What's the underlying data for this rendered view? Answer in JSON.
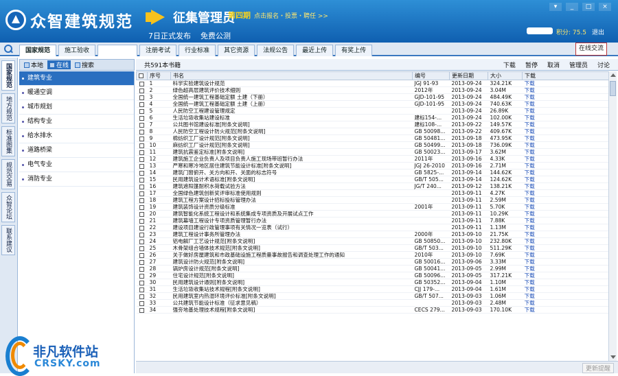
{
  "header": {
    "app_title": "众智建筑规范",
    "promo_title": "征集管理员",
    "promo_phase": "第四期",
    "promo_slogan": "点击报名・投票・聘任 >>",
    "promo_line_a": "7日正式发布",
    "promo_line_b": "免费公测",
    "score_label": "积分: 75.5",
    "logout": "退出",
    "window_buttons": [
      "▾",
      "_",
      "□",
      "×"
    ]
  },
  "tabs": [
    "国家规范",
    "施工验收",
    "",
    "注册考试",
    "行业标准",
    "其它资源",
    "法规公告",
    "最近上传",
    "有奖上传"
  ],
  "online_chat": "在线交流",
  "vertical_tabs": [
    "国家规范",
    "地方规范",
    "标准图集",
    "规范交易",
    "众智论坛",
    "联系建议"
  ],
  "left_toolbar": {
    "local": "本地",
    "online": "在线",
    "search": "搜索"
  },
  "categories": [
    "建筑专业",
    "暖通空调",
    "城市规划",
    "结构专业",
    "给水排水",
    "道路桥梁",
    "电气专业",
    "消防专业"
  ],
  "toolbar": {
    "count": "共591本书籍",
    "actions": [
      "下载",
      "暂停",
      "取消",
      "管理员",
      "讨论"
    ]
  },
  "table": {
    "headers": [
      "序号",
      "书名",
      "编号",
      "更新日期",
      "大小",
      "下载"
    ],
    "rows": [
      [
        "1",
        "科学实验建筑设计规范",
        "JGJ 91-93",
        "2013-09-24",
        "324.21K",
        "下载"
      ],
      [
        "2",
        "绿色超高层建筑评价技术细则",
        "2012年",
        "2013-09-24",
        "3.04M",
        "下载"
      ],
      [
        "3",
        "全国统一建筑工程基础定额 土建（下册）",
        "GJD-101-95",
        "2013-09-24",
        "484.49K",
        "下载"
      ],
      [
        "4",
        "全国统一建筑工程基础定额 土建（上册）",
        "GJD-101-95",
        "2013-09-24",
        "740.63K",
        "下载"
      ],
      [
        "5",
        "人民防空工程建设管理规定",
        "",
        "2013-09-24",
        "26.89K",
        "下载"
      ],
      [
        "6",
        "生活垃圾收集站建设标准",
        "建标154-...",
        "2013-09-24",
        "102.00K",
        "下载"
      ],
      [
        "7",
        "公共图书馆建设标准[附条文说明]",
        "建标108-...",
        "2013-09-22",
        "149.57K",
        "下载"
      ],
      [
        "8",
        "人民防空工程设计防火规范[附条文说明]",
        "GB 50098...",
        "2013-09-22",
        "409.67K",
        "下载"
      ],
      [
        "9",
        "棉纺织工厂设计规范[附条文说明]",
        "GB 50481...",
        "2013-09-18",
        "473.95K",
        "下载"
      ],
      [
        "10",
        "麻纺织工厂设计规范[附条文说明]",
        "GB 50499...",
        "2013-09-18",
        "736.09K",
        "下载"
      ],
      [
        "11",
        "建筑抗震鉴定标准[附条文说明]",
        "GB 50023...",
        "2013-09-17",
        "3.62M",
        "下载"
      ],
      [
        "12",
        "建筑施工企业负责人及项目负责人施工现场带班暂行办法",
        "2011年",
        "2013-09-16",
        "4.33K",
        "下载"
      ],
      [
        "13",
        "严寒和寒冷地区居住建筑节能设计标准[附条文说明]",
        "JGJ 26-2010",
        "2013-09-16",
        "2.71M",
        "下载"
      ],
      [
        "14",
        "建筑门窗俯开、关方向和开、关面的标志符号",
        "GB 5825-...",
        "2013-09-14",
        "144.62K",
        "下载"
      ],
      [
        "15",
        "民用建筑设计术语标准[附条文说明]",
        "GB/T 505...",
        "2013-09-14",
        "124.62K",
        "下载"
      ],
      [
        "16",
        "建筑遮阳篷耐积水荷载试验方法",
        "JG/T 240...",
        "2013-09-12",
        "138.21K",
        "下载"
      ],
      [
        "17",
        "全国绿色建筑创新奖评审标准使用规则",
        "",
        "2013-09-11",
        "4.27K",
        "下载"
      ],
      [
        "18",
        "建筑工程方案设计招标投标管理办法",
        "",
        "2013-09-11",
        "2.59M",
        "下载"
      ],
      [
        "19",
        "建筑装饰设计资质分级标准",
        "2001年",
        "2013-09-11",
        "5.70K",
        "下载"
      ],
      [
        "20",
        "建筑智能化系统工程设计和系统集成专项资质及开展试点工作",
        "",
        "2013-09-11",
        "10.29K",
        "下载"
      ],
      [
        "21",
        "建筑幕墙工程设计专项资质管理暂行办法",
        "",
        "2013-09-11",
        "7.88K",
        "下载"
      ],
      [
        "22",
        "建设项目建设行政管理事项有关情况一览表（试行）",
        "",
        "2013-09-11",
        "1.13M",
        "下载"
      ],
      [
        "23",
        "建筑工程设计事务所管理办法",
        "2000年",
        "2013-09-10",
        "21.75K",
        "下载"
      ],
      [
        "24",
        "铝电解厂工艺设计规范[附条文说明]",
        "GB 50850...",
        "2013-09-10",
        "232.80K",
        "下载"
      ],
      [
        "25",
        "木骨架组合墙体技术规范[附条文说明]",
        "GB/T 503...",
        "2013-09-10",
        "511.29K",
        "下载"
      ],
      [
        "26",
        "关于做好房屋建筑和市政基础设施工程质量事故报告和调查处理工作的通知",
        "2010年",
        "2013-09-10",
        "7.69K",
        "下载"
      ],
      [
        "27",
        "建筑设计防火规范[附条文说明]",
        "GB 50016...",
        "2013-09-06",
        "3.33M",
        "下载"
      ],
      [
        "28",
        "锅炉房设计规范[附条文说明]",
        "GB 50041...",
        "2013-09-05",
        "2.99M",
        "下载"
      ],
      [
        "29",
        "住宅设计规范[附条文说明]",
        "GB 50096...",
        "2013-09-05",
        "317.21K",
        "下载"
      ],
      [
        "30",
        "民用建筑设计通则[附条文说明]",
        "GB 50352...",
        "2013-09-04",
        "1.10M",
        "下载"
      ],
      [
        "31",
        "生活垃圾收集站技术规程[附条文说明]",
        "CJJ 179-...",
        "2013-09-04",
        "1.61M",
        "下载"
      ],
      [
        "32",
        "民用建筑室内热湿环境评价标准[附条文说明]",
        "GB/T 507...",
        "2013-09-03",
        "1.06M",
        "下载"
      ],
      [
        "33",
        "公共建筑节能设计标准（征求意见稿）",
        "",
        "2013-09-03",
        "2.48M",
        "下载"
      ],
      [
        "34",
        "强夯地基处理技术规程[附条文说明]",
        "CECS 279...",
        "2013-09-03",
        "170.10K",
        "下载"
      ]
    ]
  },
  "status_button": "更新提醒",
  "watermark": {
    "text": "非凡软件站",
    "url": "CRSKY.com"
  },
  "colors": {
    "banner": "#1a6fc2",
    "accent": "#2a6fc0",
    "link": "#1d4fb8",
    "promo_yellow": "#f7d21d"
  }
}
